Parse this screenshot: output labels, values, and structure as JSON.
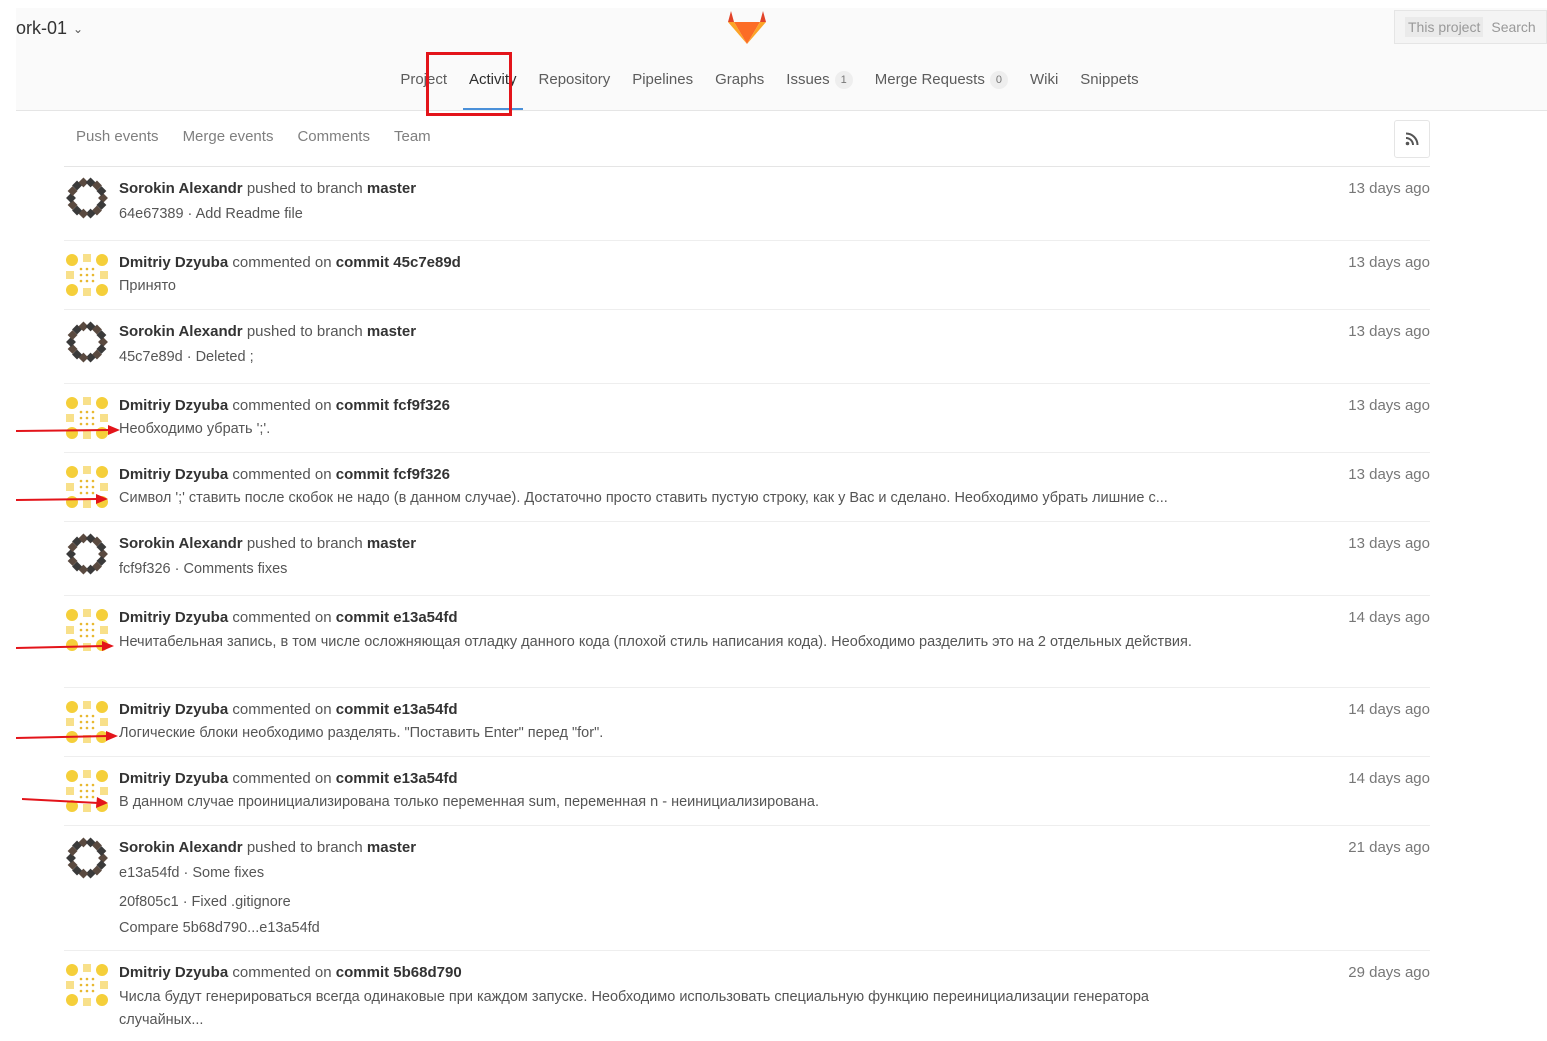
{
  "header": {
    "project_title": "ork-01",
    "search_scope": "This project",
    "search_placeholder": "Search"
  },
  "nav": {
    "items": [
      {
        "label": "Project"
      },
      {
        "label": "Activity"
      },
      {
        "label": "Repository"
      },
      {
        "label": "Pipelines"
      },
      {
        "label": "Graphs"
      },
      {
        "label": "Issues",
        "badge": "1"
      },
      {
        "label": "Merge Requests",
        "badge": "0"
      },
      {
        "label": "Wiki"
      },
      {
        "label": "Snippets"
      }
    ]
  },
  "subnav": {
    "tabs": [
      "Push events",
      "Merge events",
      "Comments",
      "Team"
    ]
  },
  "colors": {
    "accent": "#4a90d9",
    "annotation": "#e3141a"
  },
  "events": [
    {
      "author": "Sorokin Alexandr",
      "action": "pushed to branch",
      "target": "master",
      "time": "13 days ago",
      "lines": [
        "64e67389 · Add Readme file"
      ]
    },
    {
      "author": "Dmitriy Dzyuba",
      "action": "commented on",
      "target": "commit 45c7e89d",
      "time": "13 days ago",
      "lines": [
        "Принято"
      ]
    },
    {
      "author": "Sorokin Alexandr",
      "action": "pushed to branch",
      "target": "master",
      "time": "13 days ago",
      "lines": [
        "45c7e89d · Deleted ;"
      ]
    },
    {
      "author": "Dmitriy Dzyuba",
      "action": "commented on",
      "target": "commit fcf9f326",
      "time": "13 days ago",
      "lines": [
        "Необходимо убрать ';'."
      ]
    },
    {
      "author": "Dmitriy Dzyuba",
      "action": "commented on",
      "target": "commit fcf9f326",
      "time": "13 days ago",
      "lines": [
        "Символ ';' ставить после скобок не надо (в данном случае). Достаточно просто ставить пустую строку, как у Вас и сделано. Необходимо убрать лишние с..."
      ]
    },
    {
      "author": "Sorokin Alexandr",
      "action": "pushed to branch",
      "target": "master",
      "time": "13 days ago",
      "lines": [
        "fcf9f326 · Comments fixes"
      ]
    },
    {
      "author": "Dmitriy Dzyuba",
      "action": "commented on",
      "target": "commit e13a54fd",
      "time": "14 days ago",
      "lines": [
        "Нечитабельная запись, в том числе осложняющая отладку данного кода (плохой стиль написания кода). Необходимо разделить это на 2 отдельных действия."
      ]
    },
    {
      "author": "Dmitriy Dzyuba",
      "action": "commented on",
      "target": "commit e13a54fd",
      "time": "14 days ago",
      "lines": [
        "Логические блоки необходимо разделять. \"Поставить Enter\" перед \"for\"."
      ]
    },
    {
      "author": "Dmitriy Dzyuba",
      "action": "commented on",
      "target": "commit e13a54fd",
      "time": "14 days ago",
      "lines": [
        "В данном случае проинициализирована только переменная sum, переменная n - неинициализирована."
      ]
    },
    {
      "author": "Sorokin Alexandr",
      "action": "pushed to branch",
      "target": "master",
      "time": "21 days ago",
      "lines": [
        "e13a54fd · Some fixes",
        "20f805c1 · Fixed .gitignore",
        "Compare 5b68d790...e13a54fd"
      ]
    },
    {
      "author": "Dmitriy Dzyuba",
      "action": "commented on",
      "target": "commit 5b68d790",
      "time": "29 days ago",
      "lines": [
        "Числа будут генерироваться всегда одинаковые при каждом запуске. Необходимо использовать специальную функцию переинициализации генератора случайных..."
      ]
    }
  ]
}
